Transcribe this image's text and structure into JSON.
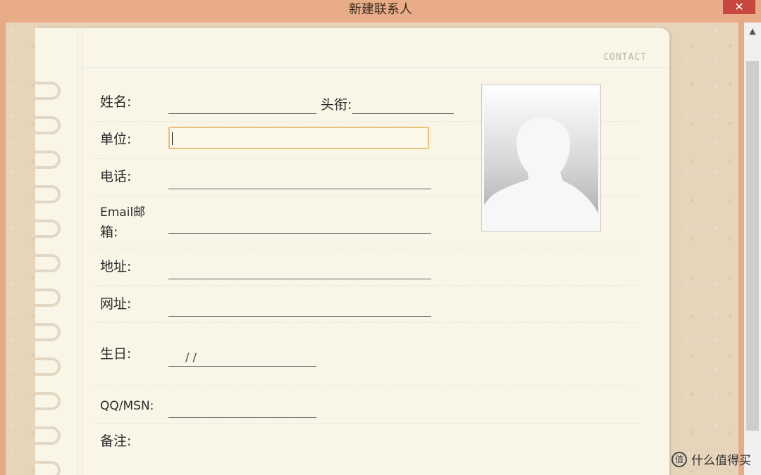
{
  "window": {
    "title": "新建联系人",
    "close_label": "✕"
  },
  "notebook": {
    "header_tag": "CONTACT"
  },
  "form": {
    "name_label": "姓名:",
    "title_label": "头衔:",
    "company_label": "单位:",
    "phone_label": "电话:",
    "email_label_line1": "Email邮",
    "email_label_line2": "箱:",
    "address_label": "地址:",
    "website_label": "网址:",
    "birthday_label": "生日:",
    "birthday_value": "/  /",
    "im_label": "QQ/MSN:",
    "note_label": "备注:"
  },
  "photo": {
    "icon": "avatar-silhouette-icon"
  },
  "scrollbar": {
    "up_arrow": "▲"
  },
  "watermark": {
    "icon_glyph": "值",
    "text": "什么值得买"
  },
  "colors": {
    "titlebar": "#e8ac88",
    "close": "#c7463f",
    "paper": "#f9f6e8",
    "focus": "#ebc17a"
  }
}
